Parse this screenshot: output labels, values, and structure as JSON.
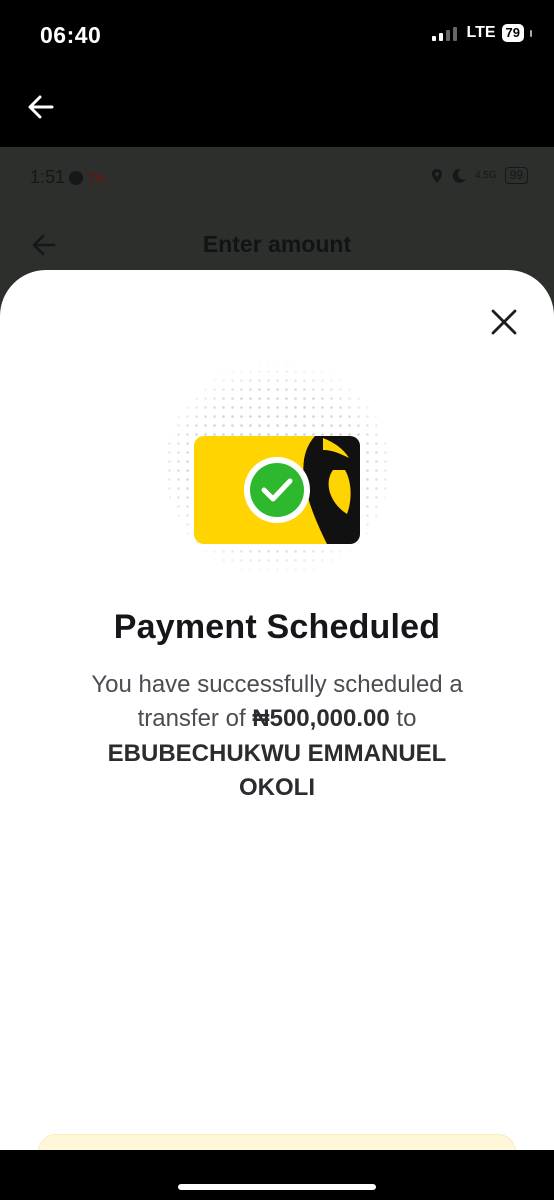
{
  "ios_status": {
    "time": "06:40",
    "network": "LTE",
    "battery": "79"
  },
  "inner_screen": {
    "time": "1:51",
    "th_badge": "TH",
    "network_label": "4.5G",
    "battery": "99",
    "title": "Enter amount"
  },
  "sheet": {
    "title": "Payment Scheduled",
    "message_line1": "You have successfully scheduled a transfer of",
    "amount": "₦500,000.00",
    "to_word": "to",
    "recipient": "EBUBECHUKWU EMMANUEL OKOLI"
  },
  "colors": {
    "card_yellow": "#FFD400",
    "check_green": "#2EB82E",
    "sheet_bg": "#FFFFFF",
    "dim_overlay": "#2C2F2C"
  },
  "icons": {
    "outer_back": "arrow-left-icon",
    "inner_back": "arrow-left-icon",
    "close": "close-icon",
    "success": "check-circle-icon"
  }
}
